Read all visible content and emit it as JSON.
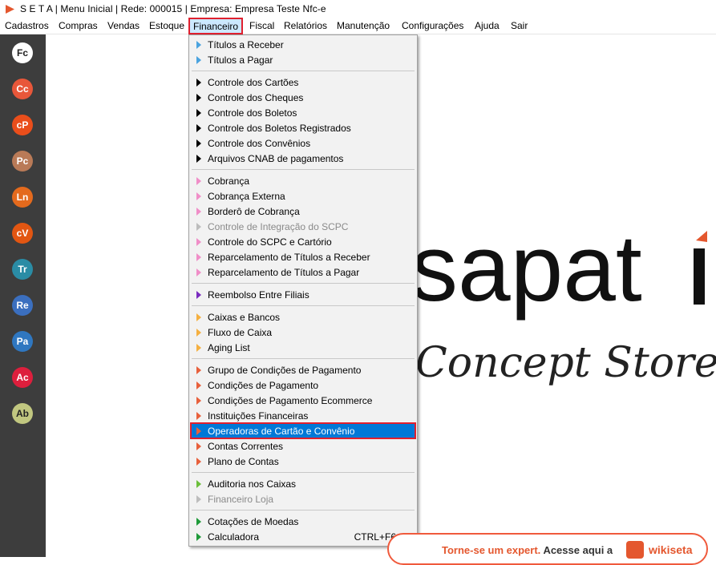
{
  "title": "S E T A | Menu Inicial | Rede: 000015 | Empresa: Empresa Teste Nfc-e",
  "menubar": [
    "Cadastros",
    "Compras",
    "Vendas",
    "Estoque",
    "Financeiro",
    "Fiscal",
    "Relatórios",
    "Manutenção",
    "Configurações",
    "Ajuda",
    "Sair"
  ],
  "sidebar": [
    {
      "label": "Fc",
      "color": "#ffffff",
      "text": "#222222"
    },
    {
      "label": "Cc",
      "color": "#e8573a",
      "text": "#ffffff"
    },
    {
      "label": "cP",
      "color": "#ea4e1b",
      "text": "#ffffff"
    },
    {
      "label": "Pc",
      "color": "#b97a57",
      "text": "#ffffff"
    },
    {
      "label": "Ln",
      "color": "#e46a1d",
      "text": "#ffffff"
    },
    {
      "label": "cV",
      "color": "#e25612",
      "text": "#ffffff"
    },
    {
      "label": "Tr",
      "color": "#2a8ca5",
      "text": "#ffffff"
    },
    {
      "label": "Re",
      "color": "#3b6fbf",
      "text": "#ffffff"
    },
    {
      "label": "Pa",
      "color": "#2f77c0",
      "text": "#ffffff"
    },
    {
      "label": "Ac",
      "color": "#dd1f3d",
      "text": "#ffffff"
    },
    {
      "label": "Ab",
      "color": "#c1c780",
      "text": "#222222"
    }
  ],
  "dropdown": [
    {
      "label": "Títulos a Receber",
      "arrow": "#4aa3df"
    },
    {
      "label": "Títulos a Pagar",
      "arrow": "#4aa3df"
    },
    {
      "sep": true
    },
    {
      "label": "Controle dos Cartões",
      "arrow": "#000000"
    },
    {
      "label": "Controle dos Cheques",
      "arrow": "#000000"
    },
    {
      "label": "Controle dos Boletos",
      "arrow": "#000000"
    },
    {
      "label": "Controle dos Boletos Registrados",
      "arrow": "#000000"
    },
    {
      "label": "Controle dos Convênios",
      "arrow": "#000000"
    },
    {
      "label": "Arquivos CNAB de pagamentos",
      "arrow": "#000000"
    },
    {
      "sep": true
    },
    {
      "label": "Cobrança",
      "arrow": "#f08ec8"
    },
    {
      "label": "Cobrança Externa",
      "arrow": "#f08ec8"
    },
    {
      "label": "Borderô de Cobrança",
      "arrow": "#f08ec8"
    },
    {
      "label": "Controle de Integração do SCPC",
      "arrow": "#bdbdbd",
      "disabled": true
    },
    {
      "label": "Controle do SCPC e Cartório",
      "arrow": "#f08ec8"
    },
    {
      "label": "Reparcelamento de Títulos a Receber",
      "arrow": "#f08ec8"
    },
    {
      "label": "Reparcelamento de Títulos a Pagar",
      "arrow": "#f08ec8"
    },
    {
      "sep": true
    },
    {
      "label": "Reembolso Entre Filiais",
      "arrow": "#7a2bbf"
    },
    {
      "sep": true
    },
    {
      "label": "Caixas e Bancos",
      "arrow": "#f5b041"
    },
    {
      "label": "Fluxo de Caixa",
      "arrow": "#f5b041"
    },
    {
      "label": "Aging List",
      "arrow": "#f5b041"
    },
    {
      "sep": true
    },
    {
      "label": "Grupo de Condições de Pagamento",
      "arrow": "#e8603c"
    },
    {
      "label": "Condições de Pagamento",
      "arrow": "#e8603c"
    },
    {
      "label": "Condições de Pagamento Ecommerce",
      "arrow": "#e8603c"
    },
    {
      "label": "Instituições Financeiras",
      "arrow": "#e8603c"
    },
    {
      "label": "Operadoras de Cartão e Convênio",
      "arrow": "#e8603c",
      "highlight": true
    },
    {
      "label": "Contas Correntes",
      "arrow": "#e8603c"
    },
    {
      "label": "Plano de Contas",
      "arrow": "#e8603c"
    },
    {
      "sep": true
    },
    {
      "label": "Auditoria nos Caixas",
      "arrow": "#6cbf3b"
    },
    {
      "label": "Financeiro Loja",
      "arrow": "#bdbdbd",
      "disabled": true
    },
    {
      "sep": true
    },
    {
      "label": "Cotações de Moedas",
      "arrow": "#1f9a3a"
    },
    {
      "label": "Calculadora",
      "arrow": "#1f9a3a",
      "shortcut": "CTRL+F6"
    }
  ],
  "logo": {
    "main": "sapat",
    "sub": "Concept Store"
  },
  "banner": {
    "text1": "Torne-se um expert.",
    "text2": "Acesse aqui a",
    "brand": "wikiseta"
  }
}
